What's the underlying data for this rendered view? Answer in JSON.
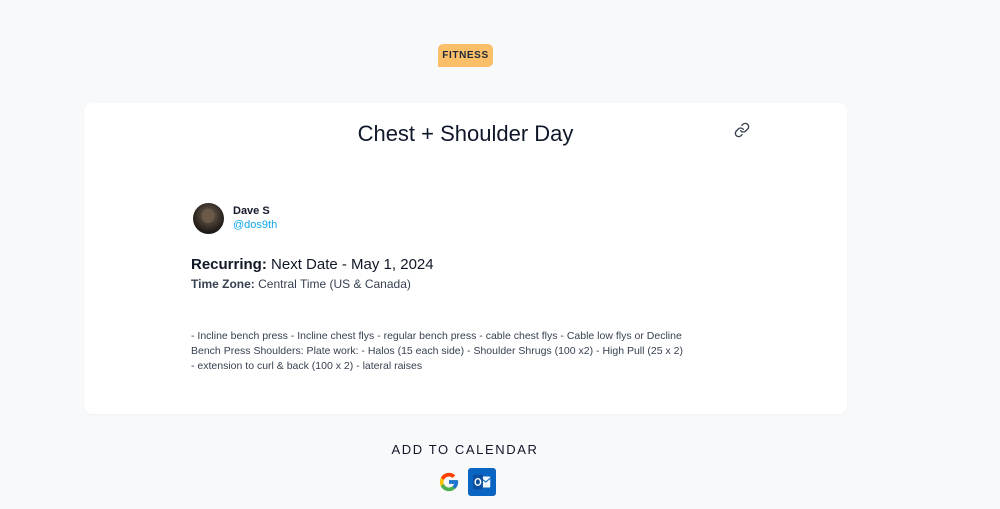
{
  "badge": {
    "label": "FITNESS",
    "color": "#fbbf6a"
  },
  "event": {
    "title": "Chest + Shoulder Day",
    "link_icon": "link-icon",
    "author": {
      "name": "Dave S",
      "handle": "@dos9th"
    },
    "recurring_label": "Recurring:",
    "recurring_value": "Next Date - May 1, 2024",
    "timezone_label": "Time Zone:",
    "timezone_value": "Central Time (US & Canada)",
    "description": "- Incline bench press - Incline chest flys - regular bench press - cable chest flys - Cable low flys or Decline Bench Press Shoulders: Plate work: - Halos (15 each side) - Shoulder Shrugs (100 x2) - High Pull (25 x 2) - extension to curl & back (100 x 2) - lateral raises"
  },
  "calendar": {
    "heading": "ADD TO CALENDAR",
    "buttons": [
      {
        "icon": "google-icon"
      },
      {
        "icon": "outlook-icon",
        "color": "#0a64c2"
      }
    ]
  },
  "colors": {
    "background": "#f8f9fb",
    "card": "#ffffff",
    "handle": "#0ea5e9"
  }
}
